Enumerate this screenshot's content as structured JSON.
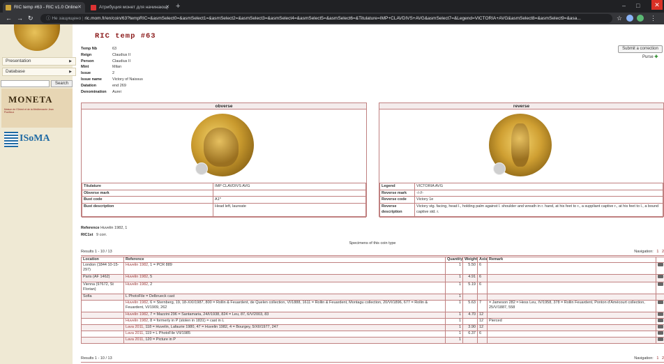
{
  "browser": {
    "tabs": [
      {
        "title": "RIC temp #63 - RIC v1.0 Online",
        "active": true
      },
      {
        "title": "Атрибуция монет для начинающ",
        "active": false
      }
    ],
    "new_tab": "+",
    "address_prefix": "Не защищено",
    "url": "ric.mom.fr/en/coin/63?tempRIC=&asmSelect0=&asmSelect1=&asmSelect2=&asmSelect3=&asmSelect4=&asmSelect5=&asmSelect6=&Titulature=IMP+CLAVDIVS+AVG&asmSelect7=&Legend=VICTORIA+AVG&asmSelect8=&asmSelect9=&asa..."
  },
  "sidebar": {
    "menu": [
      {
        "label": "Presentation"
      },
      {
        "label": "Database"
      }
    ],
    "search_button": "Search",
    "moneta_logo": "MONETA",
    "moneta_sub": "Maison de l'Orient et de la Méditerranée Jean Pouilloux",
    "isoma_logo": "ISoMA"
  },
  "page": {
    "title": "RIC temp #63",
    "submit_correction": "Submit a correction",
    "purse_label": "Purse",
    "info": [
      {
        "k": "Temp Nb",
        "v": "63"
      },
      {
        "k": "Reign",
        "v": "Claudius II"
      },
      {
        "k": "Person",
        "v": "Claudius II"
      },
      {
        "k": "Mint",
        "v": "Milan"
      },
      {
        "k": "Issue",
        "v": "2"
      },
      {
        "k": "Issue name",
        "v": "Victory of Naissus"
      },
      {
        "k": "Datation",
        "v": "end 269"
      },
      {
        "k": "Denomination",
        "v": "Aurei"
      }
    ],
    "obverse": {
      "head": "obverse",
      "rows": [
        {
          "k": "Titulature",
          "v": "IMP CLAVDIVS AVG"
        },
        {
          "k": "Obverse mark",
          "v": ""
        },
        {
          "k": "Bust code",
          "v": "A1*"
        },
        {
          "k": "Bust description",
          "v": "Head left, laureate"
        }
      ]
    },
    "reverse": {
      "head": "reverse",
      "rows": [
        {
          "k": "Legend",
          "v": "VICTORIA AVG"
        },
        {
          "k": "Reverse mark",
          "v": "-/-//-"
        },
        {
          "k": "Reverse code",
          "v": "Victory 1e"
        },
        {
          "k": "Reverse description",
          "v": "Victory stg. facing, head l., holding palm against l. shoulder and wreath in r. hand, at his feet to r., a suppliant captive r., at his feet to l., a bound captive std. r."
        }
      ]
    },
    "reference_label": "Reference",
    "reference_value": "Huvelin 1982, 1",
    "ric1st_label": "RIC1st",
    "ric1st_value": "9 corr.",
    "specimens_caption": "Specimens of this coin type",
    "results_top": "Results 1 - 10 / 13",
    "results_bottom": "Results 1 - 10 / 13",
    "navigation_label": "Navigation:",
    "pages": [
      "1",
      "2"
    ],
    "columns": [
      "Location",
      "Reference",
      "Quantity",
      "Weight",
      "Axis",
      "Remark"
    ],
    "rows": [
      {
        "loc": "London (1844 10-15-297)",
        "ref_link": "Huvelin 1982",
        "ref_rest": ", 1 = PCR 889",
        "qty": "1",
        "wt": "5.50",
        "axis": "6",
        "remark": "",
        "cam": true
      },
      {
        "loc": "Paris (AF 1462)",
        "ref_link": "Huvelin 1982",
        "ref_rest": ", 5",
        "qty": "1",
        "wt": "4.91",
        "axis": "6",
        "remark": "",
        "cam": true
      },
      {
        "loc": "Vienna (97672, St Florian)",
        "ref_link": "Huvelin 1982",
        "ref_rest": ", 2",
        "qty": "1",
        "wt": "5.19",
        "axis": "6",
        "remark": "",
        "cam": true
      },
      {
        "loc": "Sofia",
        "ref_link": "",
        "ref_rest": "L PhotoFile = Delbrueck cast",
        "qty": "1",
        "wt": "",
        "axis": "",
        "remark": "",
        "cam": false
      },
      {
        "loc": "",
        "ref_link": "Huvelin 1982",
        "ref_rest": ", 6 = Sternberg, 19, 18-XXI/1987, 800 = Rollin & Feuardent, de Quelen collection, VI/1888, 1611 = Rollin & Feuardent, Montagu collection, 20/VI/1896, 677 = Rollin & Feuardent, VI/1909, 262",
        "qty": "1",
        "wt": "5.63",
        "axis": "7",
        "remark": "= Jameson 282 = Hess Leu, IV/1958, 378 = Rollin Feuardent, Ponton d'Amécourt collection, 25/V/1887, 558",
        "cam": true
      },
      {
        "loc": "",
        "ref_link": "Huvelin 1982",
        "ref_rest": ", 7 = Mazzini 296 = Santamaria, 24/I/1938, 824 = Leu, 87, 6/V/2003, 83",
        "qty": "1",
        "wt": "4.70",
        "axis": "12",
        "remark": "",
        "cam": true
      },
      {
        "loc": "",
        "ref_link": "Huvelin 1982",
        "ref_rest": ", 8 = formerly in P (stolen in 1831) = cast in L",
        "qty": "1",
        "wt": "",
        "axis": "12",
        "remark": "Pierced",
        "cam": true
      },
      {
        "loc": "",
        "ref_link": "Lava 2011",
        "ref_rest": ", 118 = Huvelin, Lafaurie 1980, 47 = Huvelin 1982, 4 = Bourgey, 5/XII/1977, 247",
        "qty": "1",
        "wt": "3.90",
        "axis": "12",
        "remark": "",
        "cam": true
      },
      {
        "loc": "",
        "ref_link": "Lava 2011",
        "ref_rest": ", 119 = L PhotoFile VII/1985",
        "qty": "1",
        "wt": "6.37",
        "axis": "6",
        "remark": "",
        "cam": true
      },
      {
        "loc": "",
        "ref_link": "Lava 2011",
        "ref_rest": ", 120 = Picture in P",
        "qty": "1",
        "wt": "",
        "axis": "",
        "remark": "",
        "cam": true
      }
    ]
  }
}
